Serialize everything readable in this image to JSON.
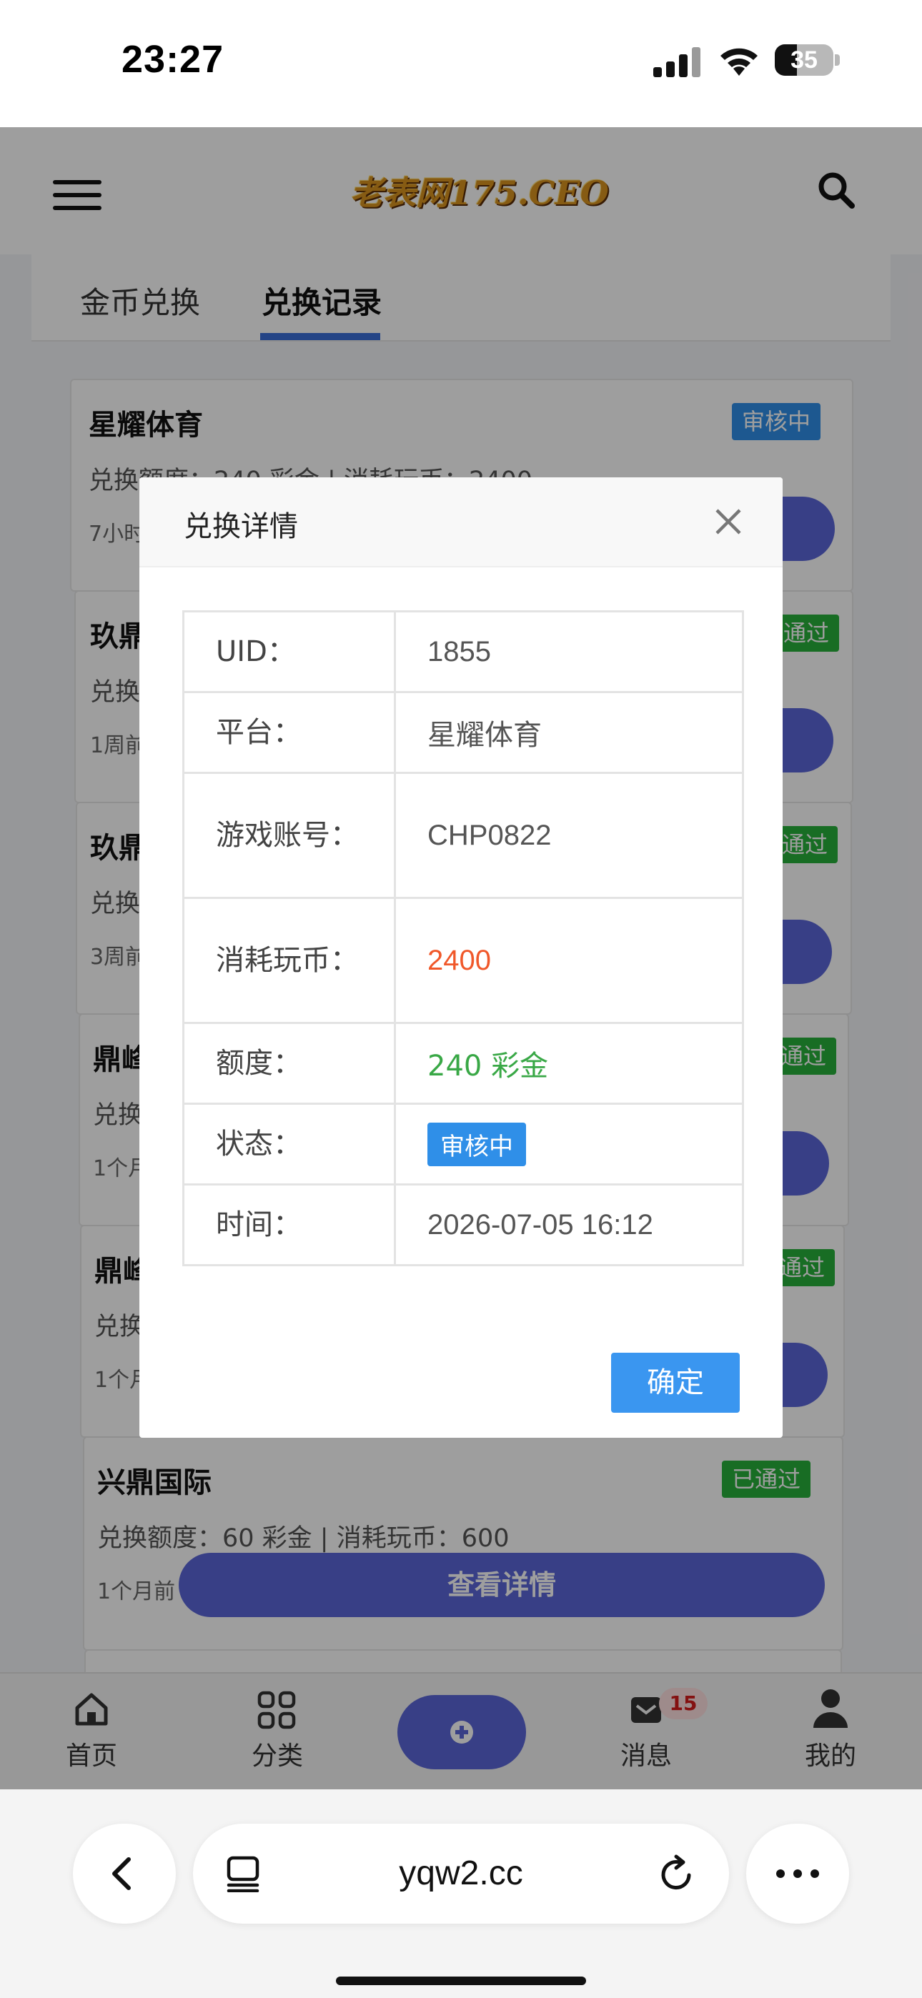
{
  "status_bar": {
    "time": "23:27",
    "battery": "35"
  },
  "header": {
    "logo_text": "老表网175.CEO"
  },
  "tabs": [
    {
      "label": "金币兑换"
    },
    {
      "label": "兑换记录"
    }
  ],
  "records": [
    {
      "title": "星耀体育",
      "status": "审核中",
      "info": "兑换额度：240 彩金 | 消耗玩币：2400",
      "time": "7小时前"
    },
    {
      "title": "玖鼎",
      "status": "已通过",
      "info": "兑换",
      "time": "1周前"
    },
    {
      "title": "玖鼎",
      "status": "已通过",
      "info": "兑换",
      "time": "3周前"
    },
    {
      "title": "鼎峰",
      "status": "已通过",
      "info": "兑换",
      "time": "1个月前"
    },
    {
      "title": "鼎峰",
      "status": "已通过",
      "info": "兑换",
      "time": "1个月前"
    },
    {
      "title": "兴鼎国际",
      "status": "已通过",
      "info": "兑换额度：60 彩金 | 消耗玩币：600",
      "time": "1个月前",
      "button": "查看详情"
    }
  ],
  "bottom_nav": [
    {
      "label": "首页",
      "icon": "home-icon"
    },
    {
      "label": "分类",
      "icon": "grid-icon"
    },
    {
      "label": "",
      "icon": "plus-circle-icon"
    },
    {
      "label": "消息",
      "icon": "mail-icon",
      "badge": "15"
    },
    {
      "label": "我的",
      "icon": "user-icon"
    }
  ],
  "modal": {
    "title": "兑换详情",
    "rows": [
      {
        "label": "UID：",
        "value": "1855"
      },
      {
        "label": "平台：",
        "value": "星耀体育"
      },
      {
        "label": "游戏账号：",
        "value": "CHP0822"
      },
      {
        "label": "消耗玩币：",
        "value": "2400"
      },
      {
        "label": "额度：",
        "value": "240 彩金"
      },
      {
        "label": "状态：",
        "value": "审核中"
      },
      {
        "label": "时间：",
        "value": "2026-07-05 16:12"
      }
    ],
    "confirm": "确定"
  },
  "colors": {
    "coin_value": "#f0582a",
    "credit_value": "#39a846",
    "accent": "#5b67d8"
  },
  "browser": {
    "url": "yqw2.cc"
  }
}
